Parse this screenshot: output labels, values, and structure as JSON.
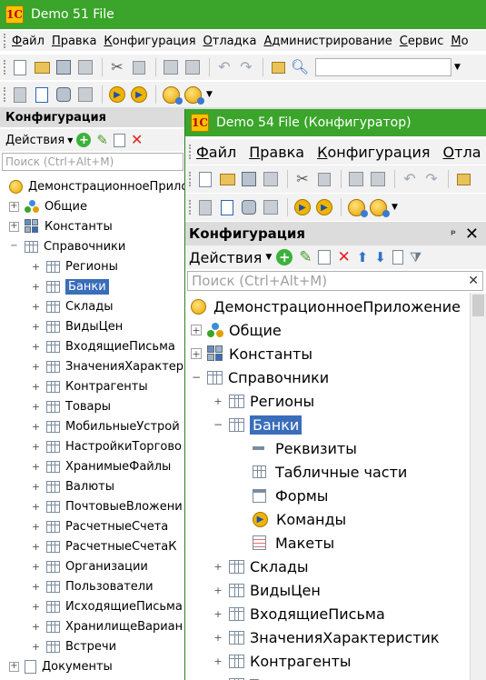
{
  "back_window": {
    "title": "Demo 51 File",
    "menu": [
      "Файл",
      "Правка",
      "Конфигурация",
      "Отладка",
      "Администрирование",
      "Сервис",
      "Мо"
    ],
    "panel_title": "Конфигурация",
    "actions_label": "Действия",
    "search_placeholder": "Поиск (Ctrl+Alt+M)",
    "root": "ДемонстрационноеПрило",
    "top_nodes": [
      "Общие",
      "Константы",
      "Справочники"
    ],
    "catalogs": [
      "Регионы",
      "Банки",
      "Склады",
      "ВидыЦен",
      "ВходящиеПисьма",
      "ЗначенияХарактер",
      "Контрагенты",
      "Товары",
      "МобильныеУстрой",
      "НастройкиТоргово",
      "ХранимыеФайлы",
      "Валюты",
      "ПочтовыеВложени",
      "РасчетныеСчета",
      "РасчетныеСчетаК",
      "Организации",
      "Пользователи",
      "ИсходящиеПисьма",
      "ХранилищеВариан",
      "Встречи"
    ],
    "selected_index": 1,
    "bottom_node": "Документы"
  },
  "front_window": {
    "title": "Demo 54 File (Конфигуратор)",
    "menu": [
      "Файл",
      "Правка",
      "Конфигурация",
      "Отла"
    ],
    "panel_title": "Конфигурация",
    "pin_icon": "ᵖ",
    "close_icon": "✕",
    "actions_label": "Действия",
    "search_placeholder": "Поиск (Ctrl+Alt+M)",
    "search_clear": "✕",
    "root": "ДемонстрационноеПриложение",
    "top_nodes": [
      "Общие",
      "Константы",
      "Справочники"
    ],
    "catalog_regions": "Регионы",
    "catalog_banks": "Банки",
    "bank_children": [
      "Реквизиты",
      "Табличные части",
      "Формы",
      "Команды",
      "Макеты"
    ],
    "catalogs_after": [
      "Склады",
      "ВидыЦен",
      "ВходящиеПисьма",
      "ЗначенияХарактеристик",
      "Контрагенты",
      "Т"
    ]
  },
  "colors": {
    "titlebar": "#3aa52a",
    "selection": "#3a6dba",
    "panel_header": "#dcdcdc"
  }
}
